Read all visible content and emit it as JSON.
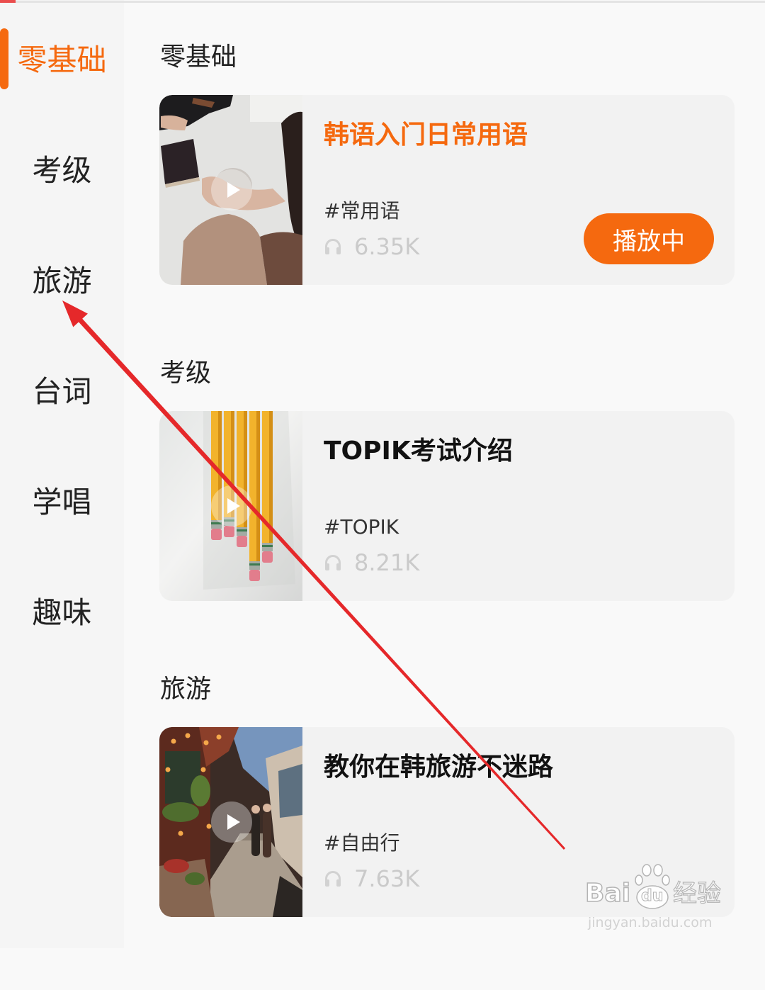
{
  "colors": {
    "accent": "#f5690f",
    "text": "#222222",
    "muted": "#cacaca",
    "annotation": "#e5282a"
  },
  "icons": {
    "play": "play-icon",
    "listens": "headphones-icon"
  },
  "sidebar": {
    "items": [
      {
        "label": "零基础",
        "active": true
      },
      {
        "label": "考级",
        "active": false
      },
      {
        "label": "旅游",
        "active": false
      },
      {
        "label": "台词",
        "active": false
      },
      {
        "label": "学唱",
        "active": false
      },
      {
        "label": "趣味",
        "active": false
      }
    ]
  },
  "sections": [
    {
      "heading": "零基础",
      "course": {
        "title": "韩语入门日常用语",
        "tag": "#常用语",
        "plays": "6.35K",
        "status": "播放中"
      }
    },
    {
      "heading": "考级",
      "course": {
        "title": "TOPIK考试介绍",
        "tag": "#TOPIK",
        "plays": "8.21K"
      }
    },
    {
      "heading": "旅游",
      "course": {
        "title": "教你在韩旅游不迷路",
        "tag": "#自由行",
        "plays": "7.63K"
      }
    }
  ],
  "watermark": {
    "brand_left": "Bai",
    "brand_paw": "du",
    "product": "经验",
    "url": "jingyan.baidu.com"
  }
}
